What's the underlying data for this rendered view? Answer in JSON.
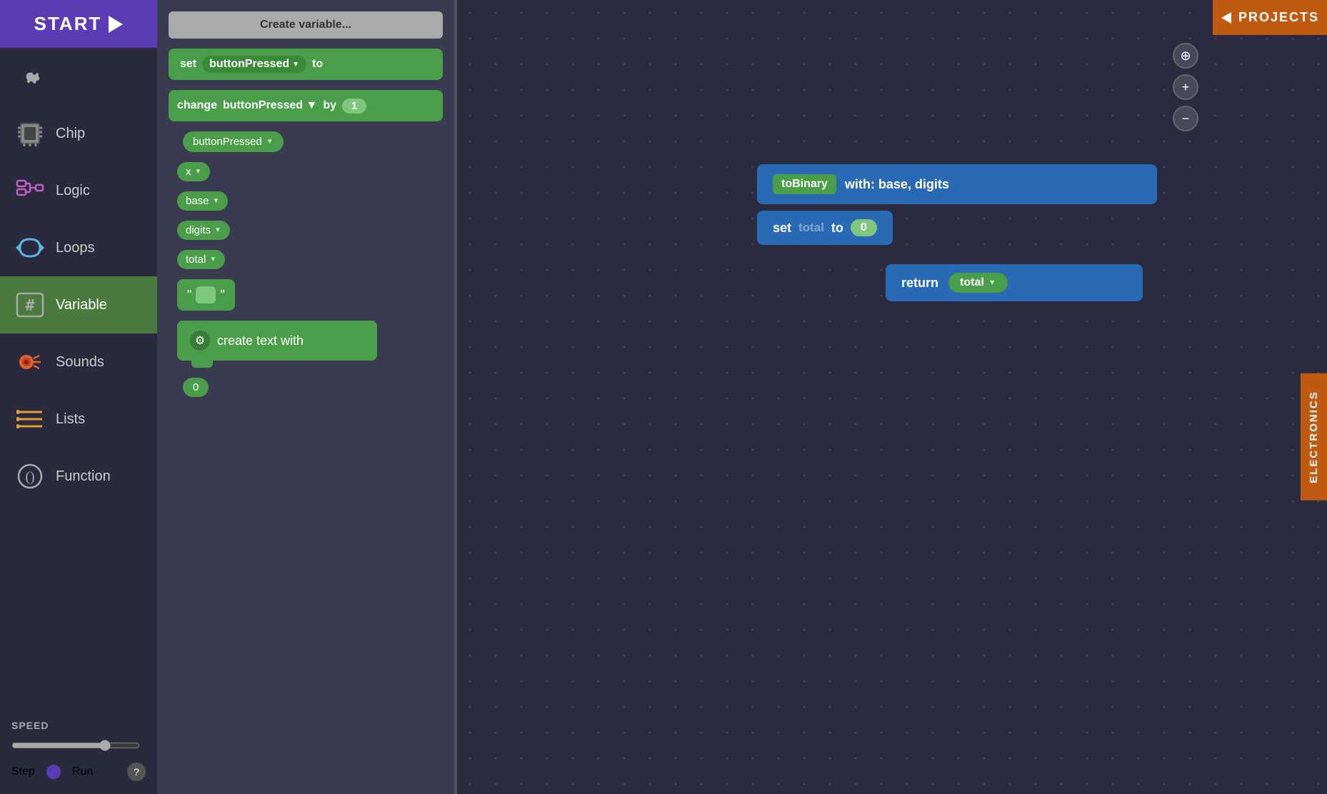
{
  "sidebar": {
    "start_label": "START",
    "items": [
      {
        "id": "settings",
        "label": "",
        "icon": "gear"
      },
      {
        "id": "chip",
        "label": "Chip",
        "icon": "chip"
      },
      {
        "id": "logic",
        "label": "Logic",
        "icon": "logic"
      },
      {
        "id": "loops",
        "label": "Loops",
        "icon": "loops"
      },
      {
        "id": "variable",
        "label": "Variable",
        "icon": "variable",
        "active": true
      },
      {
        "id": "sounds",
        "label": "Sounds",
        "icon": "sounds"
      },
      {
        "id": "lists",
        "label": "Lists",
        "icon": "lists"
      },
      {
        "id": "function",
        "label": "Function",
        "icon": "function"
      }
    ],
    "speed_label": "SPEED",
    "step_label": "Step",
    "run_label": "Run",
    "help_label": "?"
  },
  "blocks_panel": {
    "create_variable": "Create variable...",
    "set_block": {
      "keyword": "set",
      "var": "buttonPressed",
      "to": "to"
    },
    "change_block": {
      "keyword": "change",
      "var": "buttonPressed",
      "by": "by",
      "num": "1"
    },
    "vars": [
      {
        "label": "buttonPressed"
      },
      {
        "label": "x"
      },
      {
        "label": "base"
      },
      {
        "label": "digits"
      },
      {
        "label": "total"
      }
    ],
    "string_block_label": "\"  \"",
    "create_text_label": "create text with",
    "zero_label": "0"
  },
  "canvas": {
    "func_block": {
      "label": "toBinary",
      "suffix": "with: base, digits"
    },
    "set_total_block": {
      "keyword": "set",
      "var": "total",
      "to": "to",
      "val": "0"
    },
    "return_block": {
      "keyword": "return",
      "var": "total"
    }
  },
  "projects_tab_label": "PROJECTS",
  "electronics_tab_label": "ELECTRONICS",
  "canvas_controls": {
    "target": "⊕",
    "zoom_in": "+",
    "zoom_out": "−"
  }
}
